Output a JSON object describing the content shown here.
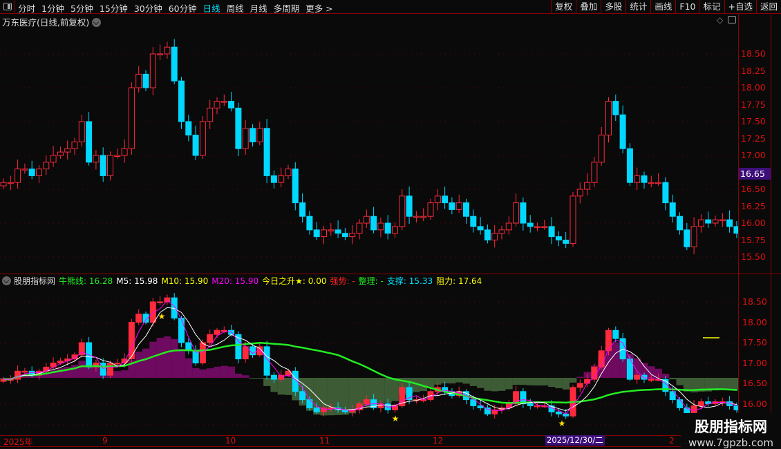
{
  "toolbar": {
    "tabs": [
      "分时",
      "1分钟",
      "5分钟",
      "15分钟",
      "30分钟",
      "60分钟",
      "日线",
      "周线",
      "月线",
      "多周期",
      "更多 >"
    ],
    "active_tab": "日线",
    "buttons": [
      "复权",
      "叠加",
      "多股",
      "统计",
      "画线",
      "F10",
      "标记",
      "+自选",
      "返回"
    ]
  },
  "upper": {
    "title": "万东医疗(日线,前复权)",
    "price_tag": "16.65",
    "axis": [
      "18.50",
      "18.25",
      "18.00",
      "17.75",
      "17.50",
      "17.25",
      "17.00",
      "16.50",
      "16.25",
      "16.00",
      "15.75",
      "15.50"
    ]
  },
  "lower": {
    "name": "股朋指标网",
    "indicators": [
      {
        "label": "牛熊线: 16.28",
        "color": "#22ee22"
      },
      {
        "label": "M5: 15.98",
        "color": "#ffffff"
      },
      {
        "label": "M10: 15.90",
        "color": "#ffff00"
      },
      {
        "label": "M20: 15.90",
        "color": "#ff00ff"
      },
      {
        "label": "今日之升★: 0.00",
        "color": "#ffff00"
      },
      {
        "label": "强势: -",
        "color": "#ff2020"
      },
      {
        "label": "整理: -",
        "color": "#22ee22"
      },
      {
        "label": "支撑: 15.33",
        "color": "#00e5ff"
      },
      {
        "label": "阻力: 17.64",
        "color": "#ffff00"
      }
    ],
    "axis": [
      "18.50",
      "18.00",
      "17.50",
      "17.00",
      "16.50",
      "16.00"
    ]
  },
  "dates": {
    "labels": [
      "2025年",
      "9",
      "10",
      "11",
      "12",
      "2"
    ],
    "cursor": "2025/12/30/二"
  },
  "watermark": {
    "name": "股朋指标网",
    "url": "www.7gpzb.com"
  },
  "colors": {
    "up": "#ff2a3c",
    "down": "#00d8ff",
    "grid": "#8b0000",
    "bull_line": "#22ee22",
    "osc_pos": "#6e0a60",
    "osc_neg": "#3d5c36"
  },
  "chart_data": {
    "type": "candlestick",
    "closes": [
      16.6,
      16.6,
      16.8,
      16.8,
      16.7,
      16.8,
      16.9,
      17.0,
      17.05,
      17.1,
      17.2,
      17.5,
      16.9,
      17.0,
      16.7,
      17.0,
      17.0,
      17.1,
      18.0,
      18.2,
      18.0,
      18.5,
      18.5,
      18.6,
      18.1,
      17.5,
      17.3,
      17.0,
      17.5,
      17.7,
      17.8,
      17.8,
      17.7,
      17.1,
      17.4,
      17.2,
      17.4,
      16.7,
      16.6,
      16.7,
      16.8,
      16.3,
      16.1,
      15.9,
      15.8,
      15.9,
      15.9,
      15.85,
      15.8,
      15.85,
      16.0,
      16.1,
      15.9,
      16.0,
      15.85,
      15.95,
      16.4,
      16.1,
      16.1,
      16.1,
      16.3,
      16.4,
      16.3,
      16.2,
      16.3,
      16.1,
      15.95,
      15.9,
      15.75,
      15.85,
      15.9,
      16.0,
      16.3,
      16.0,
      15.95,
      15.95,
      15.95,
      15.8,
      15.75,
      15.7,
      16.4,
      16.5,
      16.6,
      16.9,
      17.3,
      17.8,
      17.6,
      17.1,
      16.6,
      16.7,
      16.6,
      16.6,
      16.6,
      16.3,
      16.1,
      15.9,
      15.65,
      15.95,
      16.05,
      16.0,
      16.05,
      16.05,
      15.95,
      15.85
    ],
    "upper_ylim": [
      15.5,
      18.5
    ],
    "lower_ylim": [
      16.0,
      18.5
    ]
  }
}
